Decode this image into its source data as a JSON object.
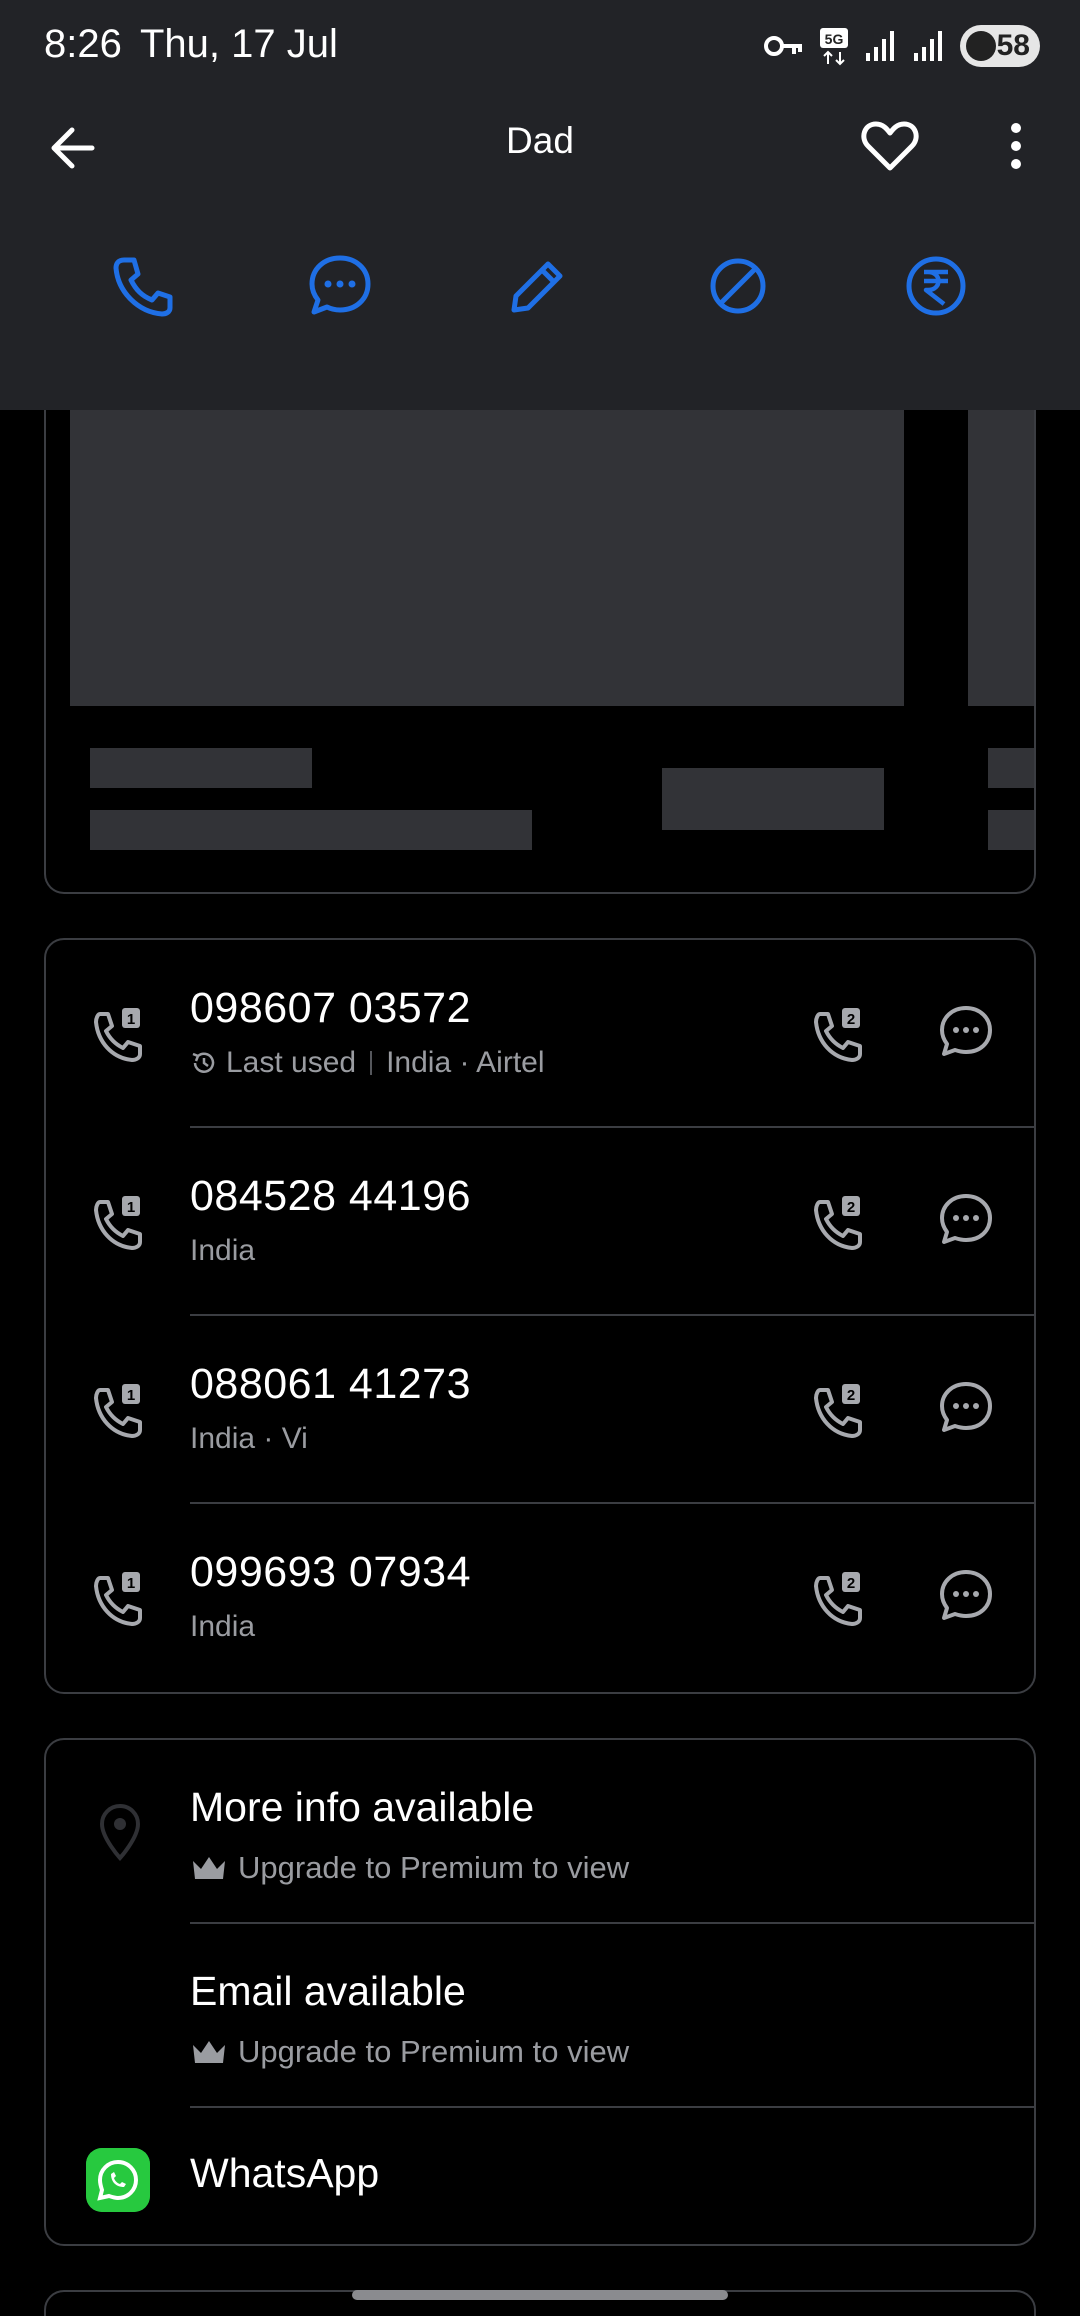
{
  "status_bar": {
    "time": "8:26",
    "date": "Thu, 17 Jul",
    "battery": "58",
    "network": "5G"
  },
  "app_bar": {
    "title": "Dad",
    "back_icon": "arrow-left-icon",
    "favorite_icon": "heart-icon",
    "more_icon": "more-vert-icon"
  },
  "actions": [
    {
      "name": "call",
      "icon": "phone-icon"
    },
    {
      "name": "message",
      "icon": "chat-bubble-icon"
    },
    {
      "name": "edit",
      "icon": "pencil-icon"
    },
    {
      "name": "block",
      "icon": "block-icon"
    },
    {
      "name": "pay",
      "icon": "rupee-icon"
    }
  ],
  "accent_color": "#1f6fe5",
  "numbers": [
    {
      "number": "098607 03572",
      "last_used": "Last used",
      "details": "India · Airtel"
    },
    {
      "number": "084528 44196",
      "details": "India"
    },
    {
      "number": "088061 41273",
      "details": "India · Vi"
    },
    {
      "number": "099693 07934",
      "details": "India"
    }
  ],
  "info": {
    "more_info": {
      "title": "More info available",
      "subtitle": "Upgrade to Premium to view"
    },
    "email": {
      "title": "Email available",
      "subtitle": "Upgrade to Premium to view"
    },
    "whatsapp": {
      "title": "WhatsApp"
    }
  }
}
